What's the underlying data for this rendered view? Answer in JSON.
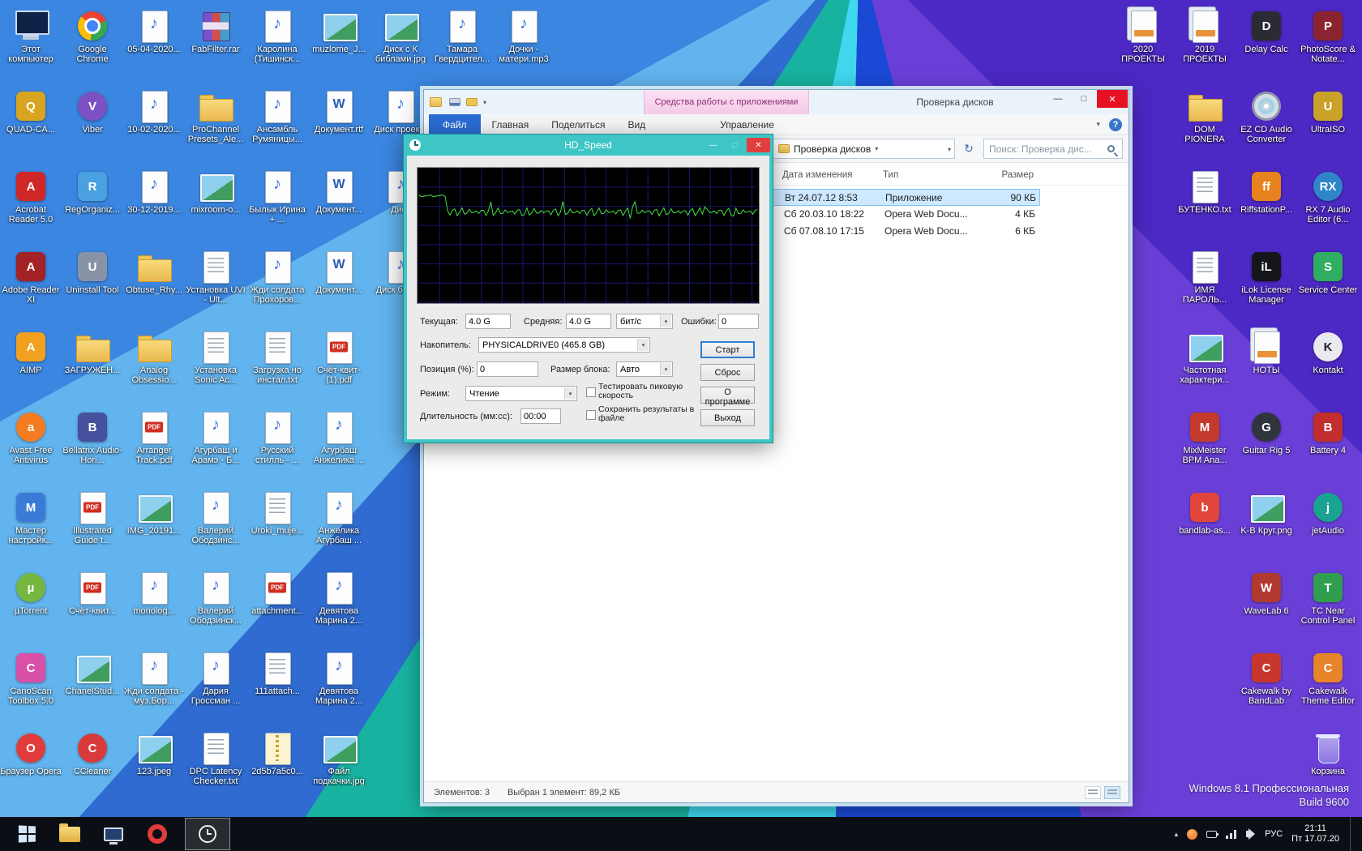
{
  "colors": {
    "hdspeed_accent": "#3ec6c6",
    "selection": "#cde8ff",
    "context_tab_pink": "#f5c9e6",
    "taskbar_bg": "#0b0f15"
  },
  "desktop": {
    "os_line1": "Windows 8.1 Профессиональная",
    "os_line2": "Build 9600",
    "left_icons": [
      {
        "c": 1,
        "r": 1,
        "label": "Этот компьютер",
        "k": "computer"
      },
      {
        "c": 1,
        "r": 2,
        "label": "QUAD-CA...",
        "k": "app",
        "bg": "#d9a520",
        "t": "Q"
      },
      {
        "c": 1,
        "r": 3,
        "label": "Acrobat Reader 5.0",
        "k": "app",
        "bg": "#cf2727",
        "t": "A"
      },
      {
        "c": 1,
        "r": 4,
        "label": "Adobe Reader XI",
        "k": "app",
        "bg": "#a32226",
        "t": "A"
      },
      {
        "c": 1,
        "r": 5,
        "label": "AIMP",
        "k": "app",
        "bg": "#f2a020",
        "t": "A"
      },
      {
        "c": 1,
        "r": 6,
        "label": "Avast Free Antivirus",
        "k": "circle",
        "bg": "#f47b20",
        "t": "a"
      },
      {
        "c": 1,
        "r": 7,
        "label": "Мастер настройк...",
        "k": "app",
        "bg": "#3b7bd8",
        "t": "М"
      },
      {
        "c": 1,
        "r": 8,
        "label": "µTorrent",
        "k": "circle",
        "bg": "#76b83f",
        "t": "µ"
      },
      {
        "c": 1,
        "r": 9,
        "label": "CanoScan Toolbox 5.0",
        "k": "app",
        "bg": "#d850a8",
        "t": "C"
      },
      {
        "c": 1,
        "r": 10,
        "label": "Браузер Opera",
        "k": "circle",
        "bg": "#e23b3b",
        "t": "O"
      },
      {
        "c": 2,
        "r": 1,
        "label": "Google Chrome",
        "k": "chrome"
      },
      {
        "c": 2,
        "r": 2,
        "label": "Viber",
        "k": "circle",
        "bg": "#7d51c3",
        "t": "V"
      },
      {
        "c": 2,
        "r": 3,
        "label": "RegOrganiz...",
        "k": "app",
        "bg": "#4aa0e0",
        "t": "R"
      },
      {
        "c": 2,
        "r": 4,
        "label": "Uninstall Tool",
        "k": "app",
        "bg": "#8893a8",
        "t": "U"
      },
      {
        "c": 2,
        "r": 5,
        "label": "ЗАГРУЖЕН...",
        "k": "folder"
      },
      {
        "c": 2,
        "r": 6,
        "label": "Bellatrix Audio-Hori...",
        "k": "app",
        "bg": "#46519e",
        "t": "B"
      },
      {
        "c": 2,
        "r": 7,
        "label": "Illustrated Guide t...",
        "k": "pdf"
      },
      {
        "c": 2,
        "r": 8,
        "label": "Счёт-квит...",
        "k": "pdf"
      },
      {
        "c": 2,
        "r": 9,
        "label": "ChanelStud...",
        "k": "image"
      },
      {
        "c": 2,
        "r": 10,
        "label": "CCleaner",
        "k": "circle",
        "bg": "#d93b3b",
        "t": "C"
      },
      {
        "c": 3,
        "r": 1,
        "label": "05-04-2020...",
        "k": "music"
      },
      {
        "c": 3,
        "r": 2,
        "label": "10-02-2020...",
        "k": "music"
      },
      {
        "c": 3,
        "r": 3,
        "label": "30-12-2019...",
        "k": "music"
      },
      {
        "c": 3,
        "r": 4,
        "label": "Obtuse_Rhy...",
        "k": "folder"
      },
      {
        "c": 3,
        "r": 5,
        "label": "Analog Obsessio...",
        "k": "folder"
      },
      {
        "c": 3,
        "r": 6,
        "label": "Arranger Track.pdf",
        "k": "pdf"
      },
      {
        "c": 3,
        "r": 7,
        "label": "IMG_20191...",
        "k": "image"
      },
      {
        "c": 3,
        "r": 8,
        "label": "monolog...",
        "k": "music"
      },
      {
        "c": 3,
        "r": 9,
        "label": "Жди солдата - муз.Бор...",
        "k": "music"
      },
      {
        "c": 3,
        "r": 10,
        "label": "123.jpeg",
        "k": "image"
      },
      {
        "c": 4,
        "r": 1,
        "label": "FabFilter.rar",
        "k": "rar"
      },
      {
        "c": 4,
        "r": 2,
        "label": "ProChannel Presets_Ale...",
        "k": "folder"
      },
      {
        "c": 4,
        "r": 3,
        "label": "mixroom-o...",
        "k": "image"
      },
      {
        "c": 4,
        "r": 4,
        "label": "Установка UVI - Ult...",
        "k": "txt"
      },
      {
        "c": 4,
        "r": 5,
        "label": "Установка Sonic Ac...",
        "k": "txt"
      },
      {
        "c": 4,
        "r": 6,
        "label": "Агурбаш и Арамэ - Б...",
        "k": "music"
      },
      {
        "c": 4,
        "r": 7,
        "label": "Валерий Ободзинс...",
        "k": "music"
      },
      {
        "c": 4,
        "r": 8,
        "label": "Валерий Ободзинск...",
        "k": "music"
      },
      {
        "c": 4,
        "r": 9,
        "label": "Дария Гроссман ...",
        "k": "music"
      },
      {
        "c": 4,
        "r": 10,
        "label": "DPC Latency Checker.txt",
        "k": "txt"
      },
      {
        "c": 5,
        "r": 1,
        "label": "Каролина (Тишинск...",
        "k": "music"
      },
      {
        "c": 5,
        "r": 2,
        "label": "Ансамбль Румяницы...",
        "k": "music"
      },
      {
        "c": 5,
        "r": 3,
        "label": "Былык Ирина + ...",
        "k": "music"
      },
      {
        "c": 5,
        "r": 4,
        "label": "Жди солдата Прохоров...",
        "k": "music"
      },
      {
        "c": 5,
        "r": 5,
        "label": "Загрузка но инстал.txt",
        "k": "txt"
      },
      {
        "c": 5,
        "r": 6,
        "label": "Русский стилль - ...",
        "k": "music"
      },
      {
        "c": 5,
        "r": 7,
        "label": "Uroki_muje...",
        "k": "txt"
      },
      {
        "c": 5,
        "r": 8,
        "label": "attachment...",
        "k": "pdf"
      },
      {
        "c": 5,
        "r": 9,
        "label": "111attach...",
        "k": "txt"
      },
      {
        "c": 5,
        "r": 10,
        "label": "2d5b7a5c0...",
        "k": "zip"
      },
      {
        "c": 6,
        "r": 1,
        "label": "muzlome_J...",
        "k": "image"
      },
      {
        "c": 6,
        "r": 2,
        "label": "Документ.rtf",
        "k": "word"
      },
      {
        "c": 6,
        "r": 3,
        "label": "Документ...",
        "k": "word"
      },
      {
        "c": 6,
        "r": 4,
        "label": "Документ...",
        "k": "word"
      },
      {
        "c": 6,
        "r": 5,
        "label": "Счёт-квит-(1).pdf",
        "k": "pdf"
      },
      {
        "c": 6,
        "r": 6,
        "label": "Агурбаш Анжелика ...",
        "k": "music"
      },
      {
        "c": 6,
        "r": 7,
        "label": "Анжелика Агурбаш ...",
        "k": "music"
      },
      {
        "c": 6,
        "r": 8,
        "label": "Девятова Марина 2...",
        "k": "music"
      },
      {
        "c": 6,
        "r": 9,
        "label": "Девятова Марина 2...",
        "k": "music"
      },
      {
        "c": 6,
        "r": 10,
        "label": "Файл подкачки.jpg",
        "k": "image"
      },
      {
        "c": 7,
        "r": 1,
        "label": "Диск с К библами.jpg",
        "k": "image"
      },
      {
        "c": 7,
        "r": 2,
        "label": "Диск проек...",
        "k": "music"
      },
      {
        "c": 7,
        "r": 3,
        "label": "Диск",
        "k": "music"
      },
      {
        "c": 7,
        "r": 4,
        "label": "Диск библ...",
        "k": "music"
      },
      {
        "c": 8,
        "r": 1,
        "label": "Тамара Гвердцител...",
        "k": "music"
      },
      {
        "c": 9,
        "r": 1,
        "label": "Дочки - матери.mp3",
        "k": "music"
      }
    ],
    "right_icons": [
      {
        "c": 1,
        "r": 1,
        "label": "2020 ПРОЕКТЫ",
        "k": "docs"
      },
      {
        "c": 2,
        "r": 1,
        "label": "2019 ПРОЕКТЫ",
        "k": "docs"
      },
      {
        "c": 3,
        "r": 1,
        "label": "Delay Calc",
        "k": "app",
        "bg": "#2b2b34",
        "t": "D"
      },
      {
        "c": 4,
        "r": 1,
        "label": "PhotoScore & Notate...",
        "k": "app",
        "bg": "#8a2430",
        "t": "P"
      },
      {
        "c": 2,
        "r": 2,
        "label": "DOM PIONERA",
        "k": "folder"
      },
      {
        "c": 3,
        "r": 2,
        "label": "EZ CD Audio Converter",
        "k": "cd"
      },
      {
        "c": 4,
        "r": 2,
        "label": "UltraISO",
        "k": "app",
        "bg": "#caa22a",
        "t": "U"
      },
      {
        "c": 2,
        "r": 3,
        "label": "БУТЕНКО.txt",
        "k": "txt"
      },
      {
        "c": 3,
        "r": 3,
        "label": "RiffstationP...",
        "k": "app",
        "bg": "#e8821e",
        "t": "ff"
      },
      {
        "c": 4,
        "r": 3,
        "label": "RX 7 Audio Editor (6...",
        "k": "circle",
        "bg": "#2e86c8",
        "t": "RX"
      },
      {
        "c": 2,
        "r": 4,
        "label": "ИМЯ ПАРОЛЬ...",
        "k": "txt"
      },
      {
        "c": 3,
        "r": 4,
        "label": "iLok License Manager",
        "k": "app",
        "bg": "#14161c",
        "t": "iL"
      },
      {
        "c": 4,
        "r": 4,
        "label": "Service Center",
        "k": "app",
        "bg": "#2fae62",
        "t": "S"
      },
      {
        "c": 2,
        "r": 5,
        "label": "Частотная характери...",
        "k": "image"
      },
      {
        "c": 3,
        "r": 5,
        "label": "НОТЫ",
        "k": "docs"
      },
      {
        "c": 4,
        "r": 5,
        "label": "Kontakt",
        "k": "circle",
        "bg": "#e9e9ef",
        "t": "K",
        "tc": "#22262e"
      },
      {
        "c": 2,
        "r": 6,
        "label": "MixMeister BPM Ana...",
        "k": "app",
        "bg": "#c43b2e",
        "t": "M"
      },
      {
        "c": 3,
        "r": 6,
        "label": "Guitar Rig 5",
        "k": "circle",
        "bg": "#30343c",
        "t": "G"
      },
      {
        "c": 4,
        "r": 6,
        "label": "Battery 4",
        "k": "app",
        "bg": "#c22d2d",
        "t": "B"
      },
      {
        "c": 2,
        "r": 7,
        "label": "bandlab-as...",
        "k": "app",
        "bg": "#e2453c",
        "t": "b"
      },
      {
        "c": 3,
        "r": 7,
        "label": "K-В Круг.png",
        "k": "image"
      },
      {
        "c": 4,
        "r": 7,
        "label": "jetAudio",
        "k": "circle",
        "bg": "#1ba392",
        "t": "j"
      },
      {
        "c": 3,
        "r": 8,
        "label": "WaveLab 6",
        "k": "app",
        "bg": "#b03a30",
        "t": "W"
      },
      {
        "c": 4,
        "r": 8,
        "label": "TC Near Control Panel",
        "k": "app",
        "bg": "#2f9e4f",
        "t": "T"
      },
      {
        "c": 3,
        "r": 9,
        "label": "Cakewalk by BandLab",
        "k": "app",
        "bg": "#c8372e",
        "t": "C"
      },
      {
        "c": 4,
        "r": 9,
        "label": "Cakewalk Theme Editor",
        "k": "app",
        "bg": "#e8842a",
        "t": "C"
      },
      {
        "c": 4,
        "r": 10,
        "label": "Корзина",
        "k": "recycle"
      }
    ]
  },
  "explorer": {
    "title": "Проверка дисков",
    "context_header": "Средства работы с приложениями",
    "tabs": [
      "Файл",
      "Главная",
      "Поделиться",
      "Вид",
      "Управление"
    ],
    "breadcrumb": "Проверка дисков",
    "search_placeholder": "Поиск: Проверка дис...",
    "columns": [
      "Дата изменения",
      "Тип",
      "Размер"
    ],
    "rows": [
      {
        "date": "Вт 24.07.12 8:53",
        "type": "Приложение",
        "size": "90 КБ",
        "selected": true
      },
      {
        "date": "Сб 20.03.10 18:22",
        "type": "Opera Web Docu...",
        "size": "4 КБ",
        "selected": false
      },
      {
        "date": "Сб 07.08.10 17:15",
        "type": "Opera Web Docu...",
        "size": "6 КБ",
        "selected": false
      }
    ],
    "status_items": "Элементов: 3",
    "status_selection": "Выбран 1 элемент: 89,2 КБ"
  },
  "hdspeed": {
    "title": "HD_Speed",
    "current_label": "Текущая:",
    "current": "4.0 G",
    "average_label": "Средняя:",
    "average": "4.0 G",
    "unit": "бит/с",
    "errors_label": "Ошибки:",
    "errors": "0",
    "drive_label": "Накопитель:",
    "drive": "PHYSICALDRIVE0 (465.8 GB)",
    "position_label": "Позиция (%):",
    "position": "0",
    "block_label": "Размер блока:",
    "block": "Авто",
    "mode_label": "Режим:",
    "mode": "Чтение",
    "check_peak": "Тестировать пиковую скорость",
    "check_save": "Сохранить результаты в файле",
    "duration_label": "Длительность (мм:сс):",
    "duration": "00:00",
    "btn_start": "Старт",
    "btn_reset": "Сброс",
    "btn_about": "О программе",
    "btn_exit": "Выход",
    "graph": {
      "line_color": "#46e046",
      "grid_color": "#17176e",
      "approx_level": "4.0 G"
    }
  },
  "taskbar": {
    "lang": "РУС",
    "time": "21:11",
    "date": "Пт 17.07.20"
  }
}
